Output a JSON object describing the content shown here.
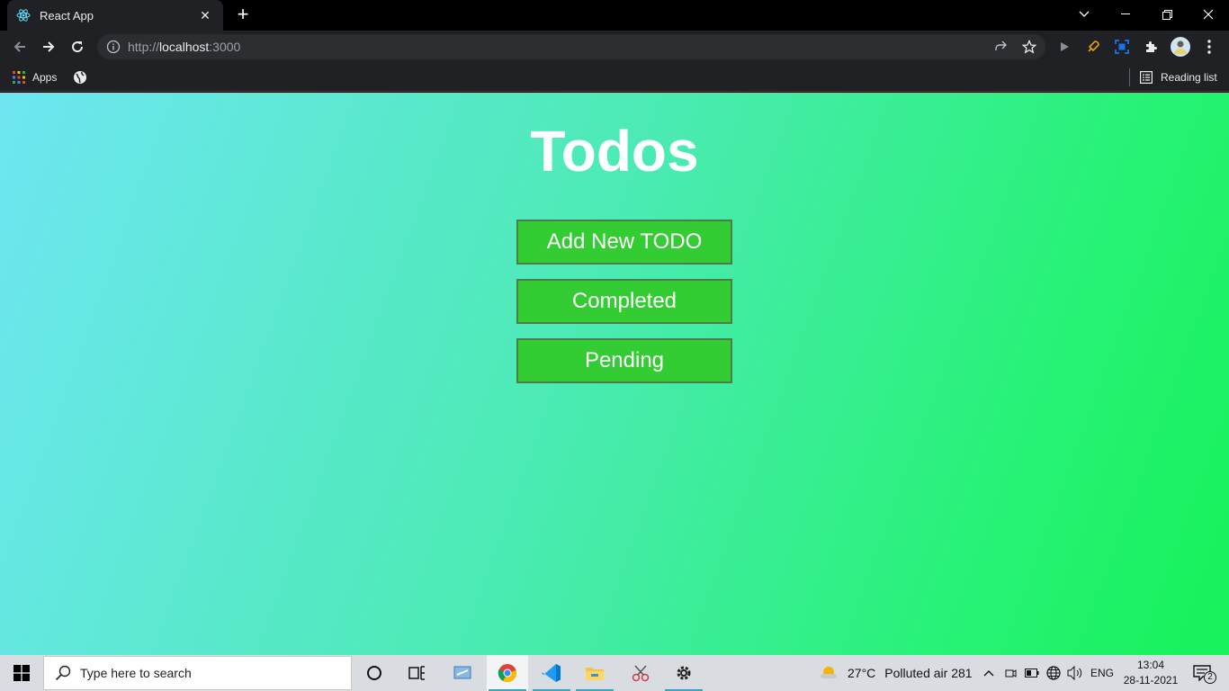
{
  "browser": {
    "tab_title": "React App",
    "url_scheme": "http://",
    "url_host": "localhost",
    "url_port": ":3000",
    "bookmarks": {
      "apps_label": "Apps",
      "reading_list_label": "Reading list"
    }
  },
  "page": {
    "title": "Todos",
    "buttons": {
      "add_label": "Add New TODO",
      "completed_label": "Completed",
      "pending_label": "Pending"
    },
    "colors": {
      "button_bg": "#33cc33",
      "gradient_start": "#6ee6f2",
      "gradient_end": "#16f25a"
    }
  },
  "taskbar": {
    "search_placeholder": "Type here to search",
    "weather_temp": "27°C",
    "weather_text": "Polluted air 281",
    "language": "ENG",
    "time": "13:04",
    "date": "28-11-2021",
    "notifications_count": "2"
  }
}
